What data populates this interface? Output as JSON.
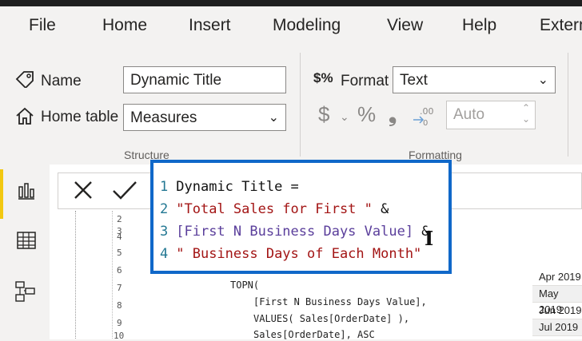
{
  "menu": [
    "File",
    "Home",
    "Insert",
    "Modeling",
    "View",
    "Help",
    "Extern"
  ],
  "structure": {
    "name_label": "Name",
    "name_value": "Dynamic Title",
    "home_table_label": "Home table",
    "home_table_value": "Measures",
    "section_label": "Structure"
  },
  "formatting": {
    "format_label": "Format",
    "format_value": "Text",
    "currency_symbol": "$",
    "percent_symbol": "%",
    "comma_symbol": "❟",
    "decimals_placeholder": "Auto",
    "section_label": "Formatting"
  },
  "editor": {
    "lines": [
      {
        "num": "1",
        "text": "Dynamic Title =",
        "kind": "plain"
      },
      {
        "num": "2",
        "text": "\"Total Sales for First \"",
        "suffix": " &",
        "kind": "str"
      },
      {
        "num": "3",
        "text": "[First N Business Days Value]",
        "suffix": " &",
        "kind": "meas"
      },
      {
        "num": "4",
        "text": "\" Business Days of Each Month\"",
        "kind": "str"
      }
    ]
  },
  "background_code": {
    "line_numbers": [
      "2",
      "3",
      "4",
      "5",
      "6",
      "7",
      "8",
      "9",
      "10"
    ],
    "lines": [
      "TOPN(",
      "[First N Business Days Value],",
      "VALUES( Sales[OrderDate] ),",
      "Sales[OrderDate], ASC"
    ]
  },
  "months": [
    "Apr 2019",
    "May 2019",
    "Jun 2019",
    "Jul 2019"
  ],
  "colors": {
    "accent": "#1068c9",
    "string": "#a31515",
    "measure": "#5a3e9b"
  }
}
